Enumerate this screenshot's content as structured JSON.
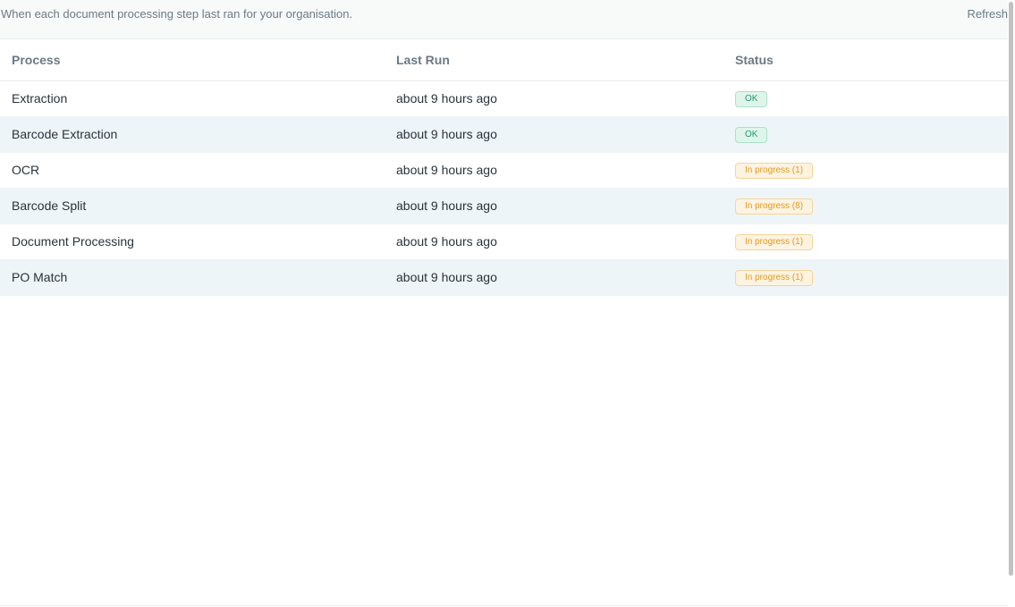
{
  "header": {
    "subtitle": "When each document processing step last ran for your organisation.",
    "refresh_label": "Refresh"
  },
  "table": {
    "columns": [
      "Process",
      "Last Run",
      "Status"
    ],
    "rows": [
      {
        "process": "Extraction",
        "last_run": "about 9 hours ago",
        "status": "OK",
        "status_kind": "ok"
      },
      {
        "process": "Barcode Extraction",
        "last_run": "about 9 hours ago",
        "status": "OK",
        "status_kind": "ok"
      },
      {
        "process": "OCR",
        "last_run": "about 9 hours ago",
        "status": "In progress (1)",
        "status_kind": "progress"
      },
      {
        "process": "Barcode Split",
        "last_run": "about 9 hours ago",
        "status": "In progress (8)",
        "status_kind": "progress"
      },
      {
        "process": "Document Processing",
        "last_run": "about 9 hours ago",
        "status": "In progress (1)",
        "status_kind": "progress"
      },
      {
        "process": "PO Match",
        "last_run": "about 9 hours ago",
        "status": "In progress (1)",
        "status_kind": "progress"
      }
    ]
  },
  "colors": {
    "row_stripe": "#edf5f8",
    "ok_text": "#1f9a6a",
    "progress_text": "#e29a1f",
    "header_text": "#6b7a86"
  }
}
